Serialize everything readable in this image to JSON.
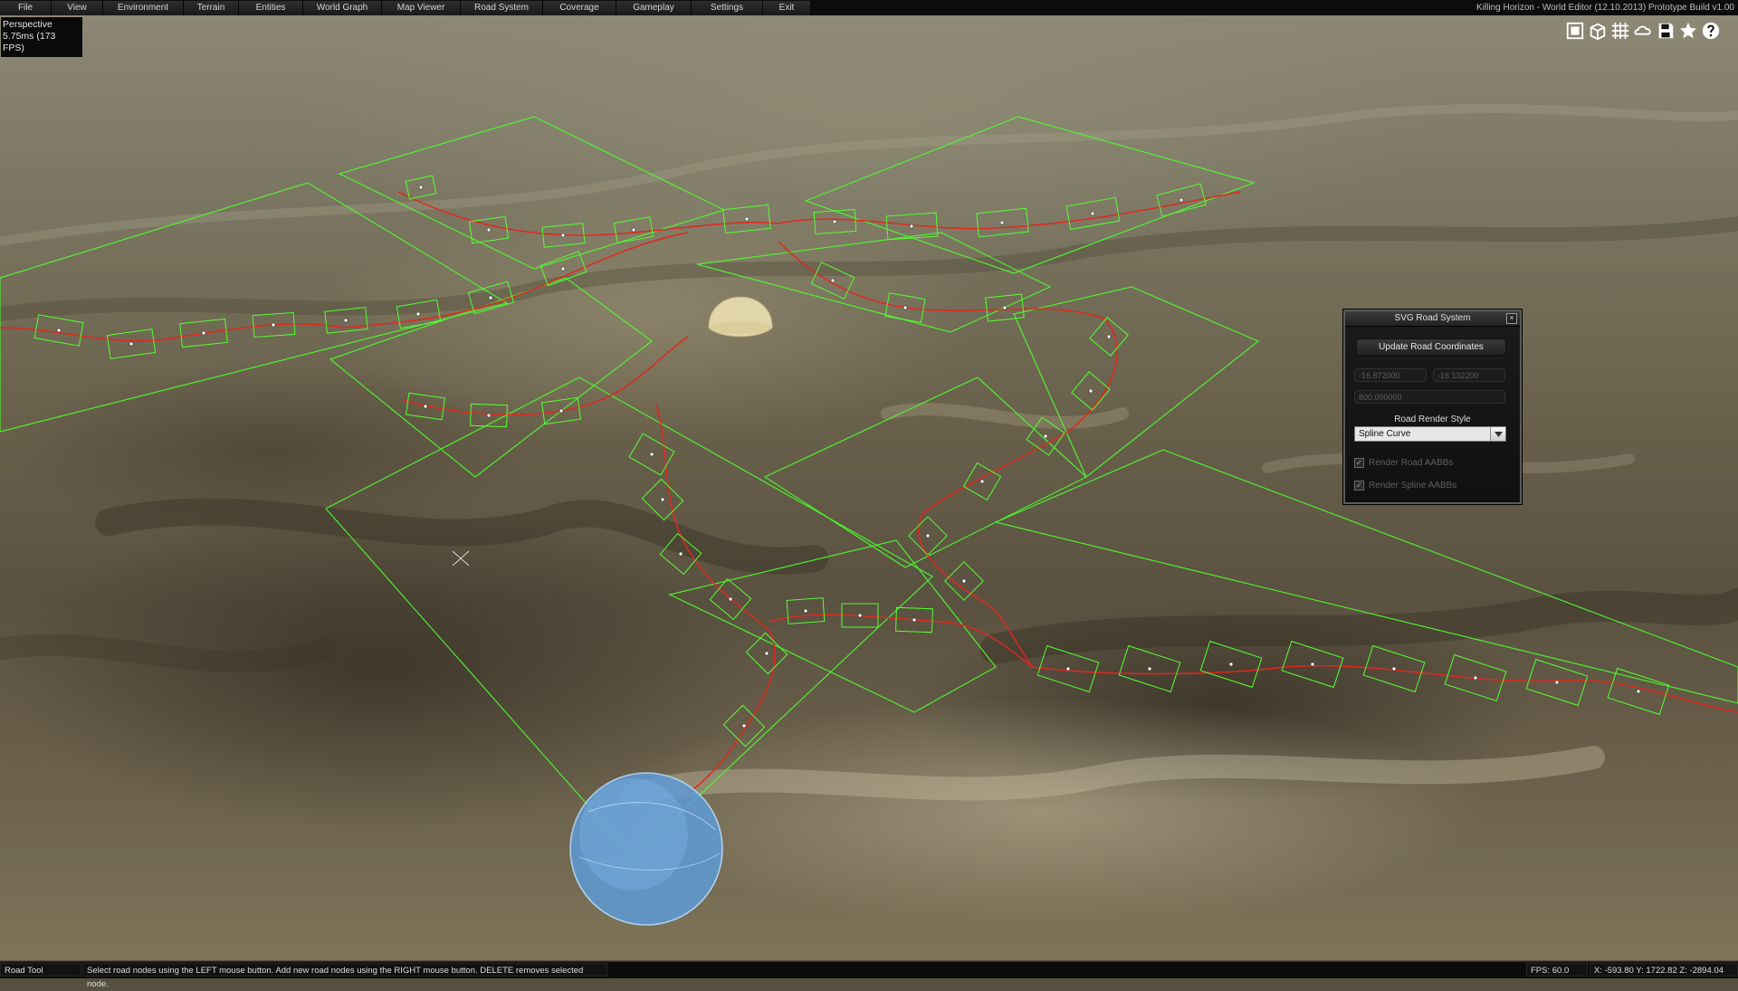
{
  "app_title": "Killing Horizon - World Editor (12.10.2013) Prototype Build v1.00",
  "menu": [
    {
      "label": "File"
    },
    {
      "label": "View"
    },
    {
      "label": "Environment"
    },
    {
      "label": "Terrain"
    },
    {
      "label": "Entities"
    },
    {
      "label": "World Graph"
    },
    {
      "label": "Map Viewer"
    },
    {
      "label": "Road System"
    },
    {
      "label": "Coverage"
    },
    {
      "label": "Gameplay"
    },
    {
      "label": "Settings"
    },
    {
      "label": "Exit"
    }
  ],
  "viewport": {
    "mode": "Perspective",
    "frame_time": "5.75ms (173 FPS)"
  },
  "toolbar_icons": [
    "single-view-icon",
    "cube-view-icon",
    "grid-icon",
    "cloud-icon",
    "save-icon",
    "star-icon",
    "help-icon"
  ],
  "road_panel": {
    "title": "SVG Road System",
    "close_glyph": "×",
    "update_button": "Update Road Coordinates",
    "coord_x": "-16.872000",
    "coord_y": "-16.132200",
    "coord_z": "800.000000",
    "render_style_label": "Road Render Style",
    "render_style_value": "Spline Curve",
    "render_road_aabbs": "Render Road AABBs",
    "render_spline_aabbs": "Render Spline AABBs"
  },
  "status": {
    "tool": "Road Tool",
    "hint": "Select road nodes using the LEFT mouse button.  Add new road nodes using the RIGHT mouse button.  DELETE removes selected node.",
    "fps": "FPS: 60.0",
    "coords": "X: -593.80 Y: 1722.82 Z: -2894.04"
  },
  "colors": {
    "aabb_green": "#4dff2e",
    "spline_red": "#e0281e",
    "menu_bg": "#0d0d0d",
    "gizmo_blue": "#5e9bd6"
  }
}
